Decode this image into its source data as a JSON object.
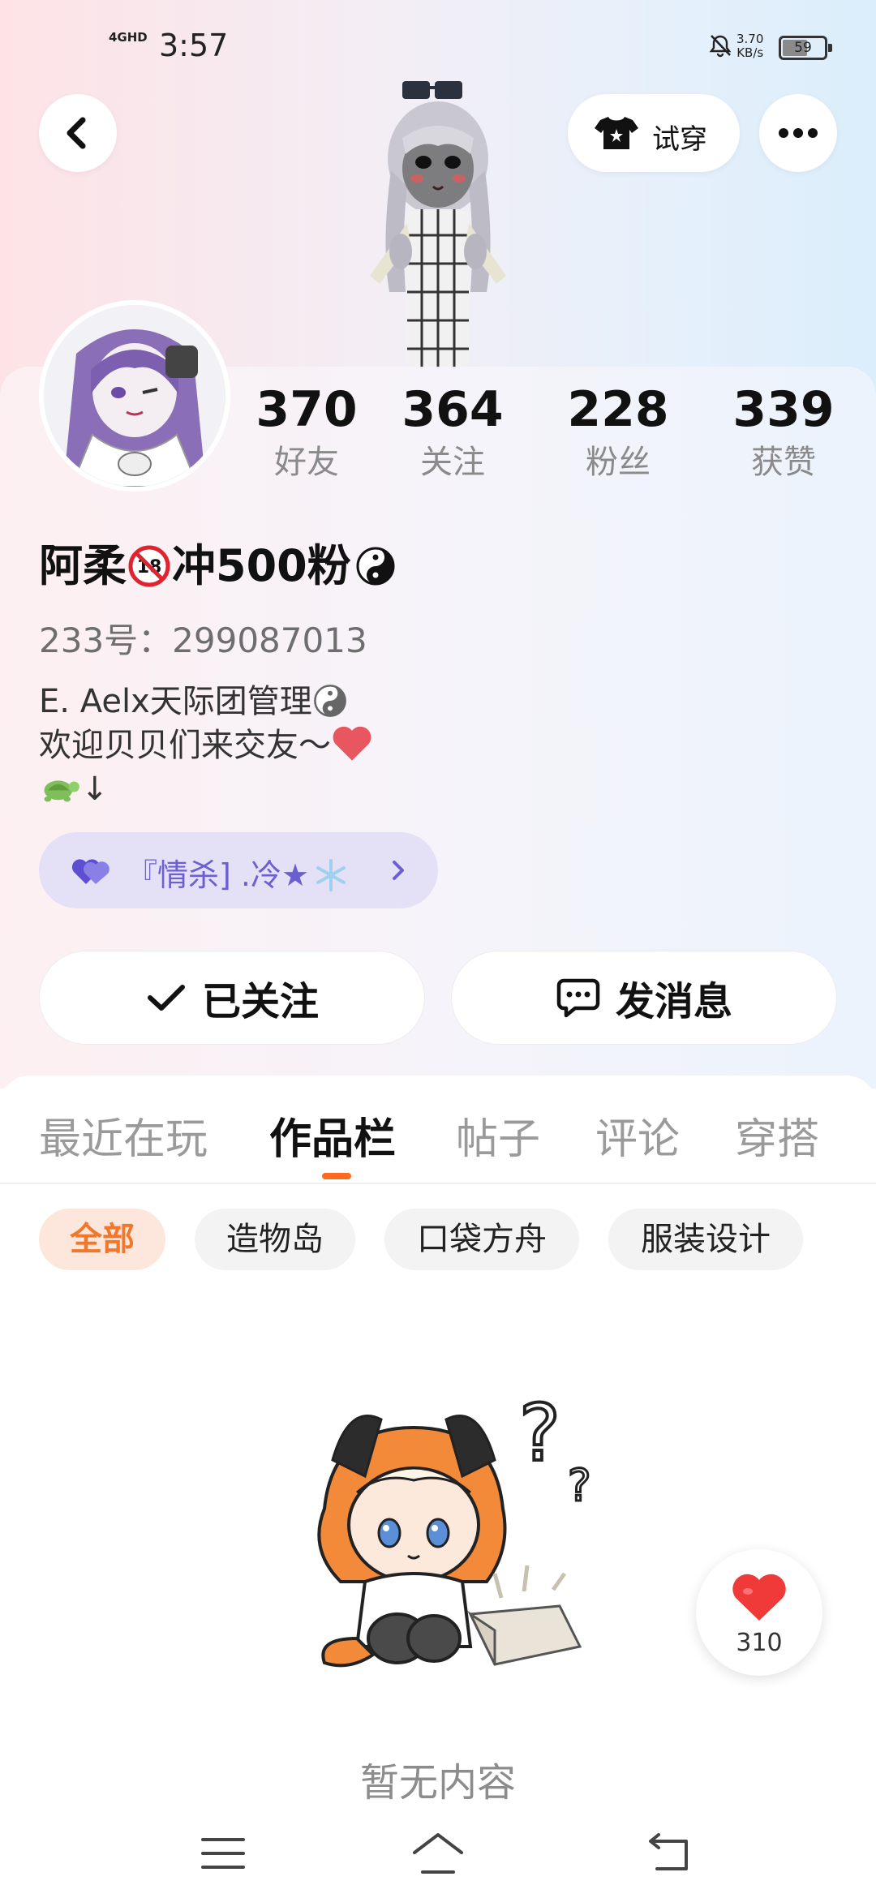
{
  "status_bar": {
    "network": "4GHD",
    "time": "3:57",
    "speed_value": "3.70",
    "speed_unit": "KB/s",
    "battery": "59",
    "battery_level": 0.59
  },
  "header": {
    "tryon_label": "试穿"
  },
  "stats": [
    {
      "value": "370",
      "label": "好友"
    },
    {
      "value": "364",
      "label": "关注"
    },
    {
      "value": "228",
      "label": "粉丝"
    },
    {
      "value": "339",
      "label": "获赞"
    }
  ],
  "profile": {
    "nickname_part1": "阿柔",
    "nickname_part2": "冲500粉",
    "user_id": "233号：299087013",
    "bio_line1": "E. Aelx天际团管理",
    "bio_line2": "欢迎贝贝们来交友～",
    "bio_line3": "↓",
    "group_label": "『情杀] .冷★"
  },
  "actions": {
    "follow_label": "已关注",
    "message_label": "发消息"
  },
  "tabs": [
    {
      "label": "最近在玩",
      "active": false
    },
    {
      "label": "作品栏",
      "active": true
    },
    {
      "label": "帖子",
      "active": false
    },
    {
      "label": "评论",
      "active": false
    },
    {
      "label": "穿搭",
      "active": false
    }
  ],
  "chips": [
    {
      "label": "全部",
      "active": true
    },
    {
      "label": "造物岛",
      "active": false
    },
    {
      "label": "口袋方舟",
      "active": false
    },
    {
      "label": "服装设计",
      "active": false
    }
  ],
  "empty": {
    "text": "暂无内容"
  },
  "like_fab": {
    "count": "310"
  },
  "colors": {
    "accent": "#ff6a1f",
    "group_purple": "#6b5fd1",
    "heart_red": "#f03a3a"
  },
  "icons": [
    "back-icon",
    "tshirt-icon",
    "more-icon",
    "check-icon",
    "message-icon",
    "heart-icon",
    "menu-icon",
    "home-icon",
    "return-icon"
  ]
}
